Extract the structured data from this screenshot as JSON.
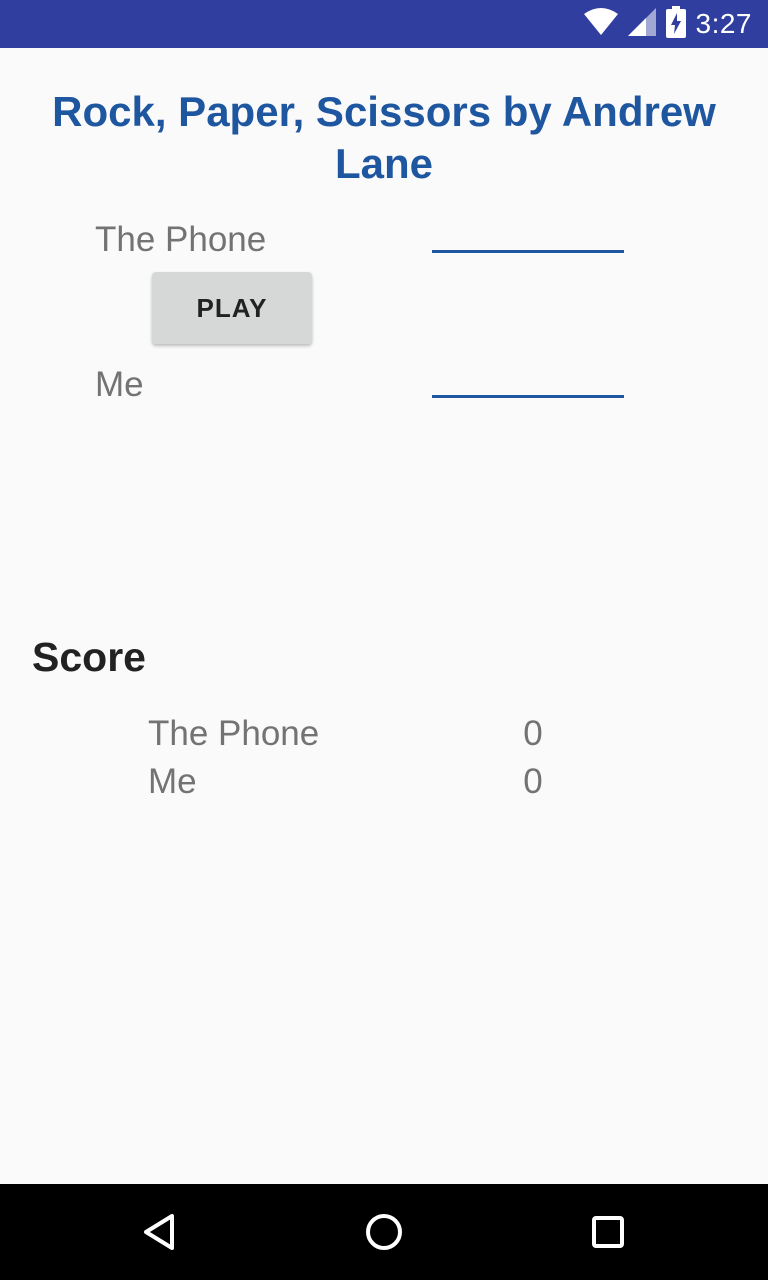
{
  "status_bar": {
    "time": "3:27",
    "icons": [
      "wifi-icon",
      "signal-icon",
      "battery-charging-icon"
    ],
    "background": "#303f9f"
  },
  "title": "Rock, Paper, Scissors by Andrew Lane",
  "game": {
    "phone_label": "The Phone",
    "phone_choice": "",
    "play_button": "PLAY",
    "me_label": "Me",
    "me_choice": ""
  },
  "score": {
    "heading": "Score",
    "rows": [
      {
        "label": "The Phone",
        "value": "0"
      },
      {
        "label": "Me",
        "value": "0"
      }
    ]
  },
  "nav_bar": {
    "buttons": [
      "back-icon",
      "home-icon",
      "recents-icon"
    ]
  },
  "colors": {
    "title": "#1e56a0",
    "accent_line": "#1e56a0",
    "button": "#d6d7d7",
    "label": "#737373"
  }
}
